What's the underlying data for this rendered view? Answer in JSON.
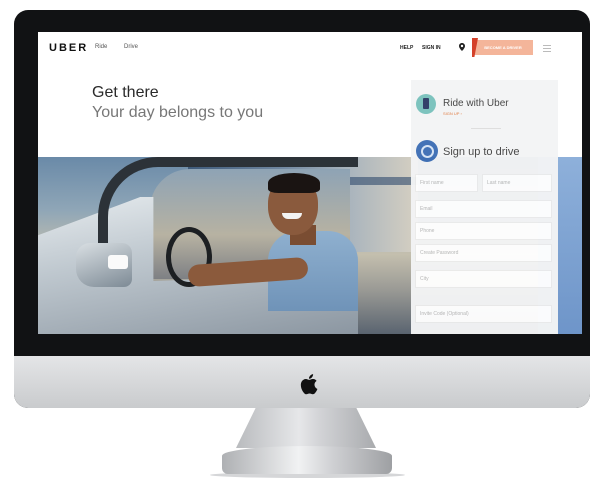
{
  "nav": {
    "logo": "UBER",
    "links": [
      "Ride",
      "Drive"
    ],
    "help": "HELP",
    "sign_in": "SIGN IN",
    "become_driver": "BECOME A DRIVER",
    "pin_icon": "location-pin-icon",
    "menu_icon": "hamburger-menu-icon"
  },
  "hero": {
    "title": "Get there",
    "subtitle": "Your day belongs to you"
  },
  "panel": {
    "ride_title": "Ride with Uber",
    "ride_signup": "SIGN UP  ›",
    "drive_title": "Sign up to drive",
    "fields": {
      "first_name": "First name",
      "last_name": "Last name",
      "email": "Email",
      "phone": "Phone",
      "password": "Create Password",
      "city": "City",
      "invite_code": "Invite Code (Optional)"
    }
  },
  "device": {
    "logo_icon": "apple-logo-icon"
  },
  "colors": {
    "accent": "#f4b59a",
    "flag": "#d4412a",
    "ride_icon": "#79c2bc",
    "drive_icon": "#3e6fb5",
    "bezel": "#111214"
  }
}
